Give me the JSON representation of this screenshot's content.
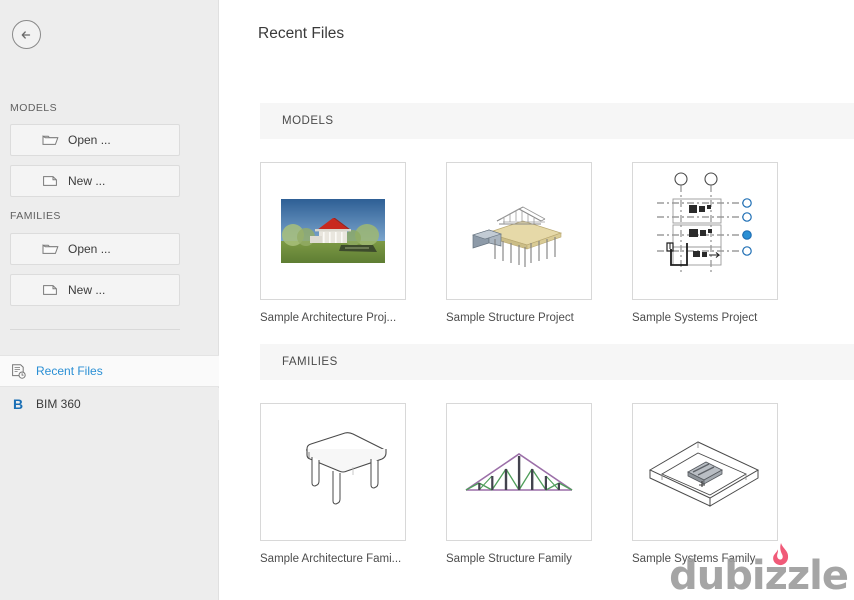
{
  "window": {
    "background": "#ffffff"
  },
  "sidebar": {
    "background": "#ededed",
    "back_button": {
      "icon": "arrow-left-circle-icon",
      "label": ""
    },
    "sections": [
      {
        "heading": "MODELS",
        "buttons": [
          {
            "icon": "open-folder-icon",
            "label": "Open ..."
          },
          {
            "icon": "new-file-icon",
            "label": "New ..."
          }
        ]
      },
      {
        "heading": "FAMILIES",
        "buttons": [
          {
            "icon": "open-folder-icon",
            "label": "Open ..."
          },
          {
            "icon": "new-file-icon",
            "label": "New ..."
          }
        ]
      }
    ],
    "nav": [
      {
        "icon": "recent-files-icon",
        "label": "Recent Files",
        "selected": true,
        "color": "#2a8fd4"
      },
      {
        "icon": "bim360-logo-icon",
        "label": "BIM 360",
        "selected": false,
        "color": "#3b3b3b"
      }
    ]
  },
  "main": {
    "title": "Recent Files",
    "groups": [
      {
        "heading": "MODELS",
        "items": [
          {
            "caption": "Sample Architecture Proj...",
            "thumb": "architecture-render-thumbnail"
          },
          {
            "caption": "Sample Structure Project",
            "thumb": "structure-model-thumbnail"
          },
          {
            "caption": "Sample Systems Project",
            "thumb": "systems-plan-thumbnail"
          }
        ]
      },
      {
        "heading": "FAMILIES",
        "items": [
          {
            "caption": "Sample Architecture Fami...",
            "thumb": "table-family-thumbnail"
          },
          {
            "caption": "Sample Structure Family",
            "thumb": "truss-family-thumbnail"
          },
          {
            "caption": "Sample Systems Family",
            "thumb": "light-fixture-family-thumbnail"
          }
        ]
      }
    ]
  },
  "watermark": {
    "text": "dubizzle",
    "flame_color": "#f05a78",
    "text_color": "#9e9e9e"
  },
  "colors": {
    "accent": "#2a8fd4",
    "bim_blue": "#1a6fb5",
    "sidebar": "#ededed",
    "group_band": "#f6f6f6",
    "truss_chord": "#9b6fa8",
    "truss_web": "#4f9e5a",
    "truss_post": "#4a4a52",
    "render_sky": "#4a7fb5",
    "render_roof": "#c8281e",
    "render_grass": "#6e8f3c"
  }
}
